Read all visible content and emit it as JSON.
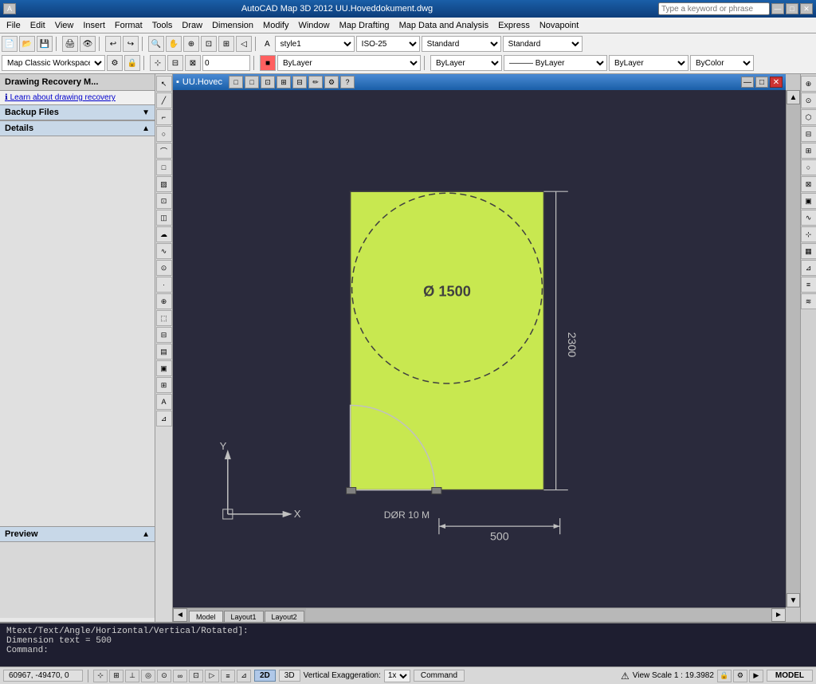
{
  "title_bar": {
    "text": "AutoCAD Map 3D 2012    UU.Hoveddokument.dwg",
    "search_placeholder": "Type a keyword or phrase",
    "min_label": "—",
    "max_label": "□",
    "close_label": "✕"
  },
  "menu": {
    "items": [
      "File",
      "Edit",
      "View",
      "Insert",
      "Format",
      "Tools",
      "Draw",
      "Dimension",
      "Modify",
      "Window",
      "Map Drafting",
      "Map Data and Analysis",
      "Express",
      "Novapoint"
    ]
  },
  "workspace": {
    "name": "Map Classic Workspace"
  },
  "left_panel": {
    "title": "Drawing Recovery M...",
    "link": "Learn about drawing recovery",
    "backup_label": "Backup Files",
    "details_label": "Details",
    "preview_label": "Preview"
  },
  "doc_window": {
    "title": "UU.Hovec",
    "toolbar_icons": [
      "□",
      "□",
      "□",
      "□",
      "□",
      "□",
      "□",
      "□",
      "□",
      "□",
      "□",
      "□",
      "?"
    ]
  },
  "tabs": {
    "items": [
      "Model",
      "Layout1",
      "Layout2"
    ]
  },
  "drawing": {
    "circle_label": "Ø 1500",
    "dimension_vertical": "2300",
    "dimension_horizontal": "500",
    "door_label": "DØR 10 M",
    "axis_x": "X",
    "axis_y": "Y"
  },
  "bottom_controls": {
    "mode_2d": "2D",
    "mode_3d": "3D",
    "exaggeration": "Vertical Exaggeration:",
    "exaggeration_value": "1x",
    "command_label": "Command",
    "view_scale": "View Scale 1 : 19.3982",
    "mode_model": "MODEL"
  },
  "command_text": {
    "line1": "Mtext/Text/Angle/Horizontal/Vertical/Rotated]:",
    "line2": "Dimension text = 500",
    "line3": "Command:"
  },
  "coords": {
    "value": "60967, -49470, 0"
  },
  "layers": {
    "color": "ByLayer",
    "linetype": "ByLayer",
    "lineweight": "ByLayer",
    "plot_style": "ByColor",
    "style": "style1",
    "dimstyle": "ISO-25",
    "textstyle": "Standard",
    "plotstyle2": "Standard"
  }
}
